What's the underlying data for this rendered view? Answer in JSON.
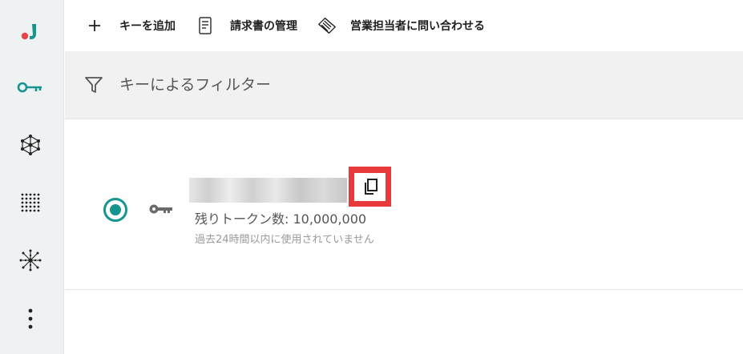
{
  "sidebar": {
    "items": [
      {
        "name": "logo",
        "icon": "brand-logo"
      },
      {
        "name": "api-keys",
        "icon": "key-icon",
        "active": true
      },
      {
        "name": "embeddings",
        "icon": "network-icon"
      },
      {
        "name": "grid",
        "icon": "dot-grid-icon"
      },
      {
        "name": "models",
        "icon": "sparkle-network-icon"
      },
      {
        "name": "more",
        "icon": "more-vertical-icon"
      }
    ],
    "accent_color": "#14958f"
  },
  "toolbar": {
    "add_key_label": "キーを追加",
    "billing_label": "請求書の管理",
    "contact_sales_label": "営業担当者に問い合わせる"
  },
  "filter": {
    "placeholder": "キーによるフィルター"
  },
  "key": {
    "selected": true,
    "tokens_remaining_text": "残りトークン数: 10,000,000",
    "usage_text": "過去24時間以内に使用されていません",
    "copy_highlight_color": "#e8393b"
  }
}
